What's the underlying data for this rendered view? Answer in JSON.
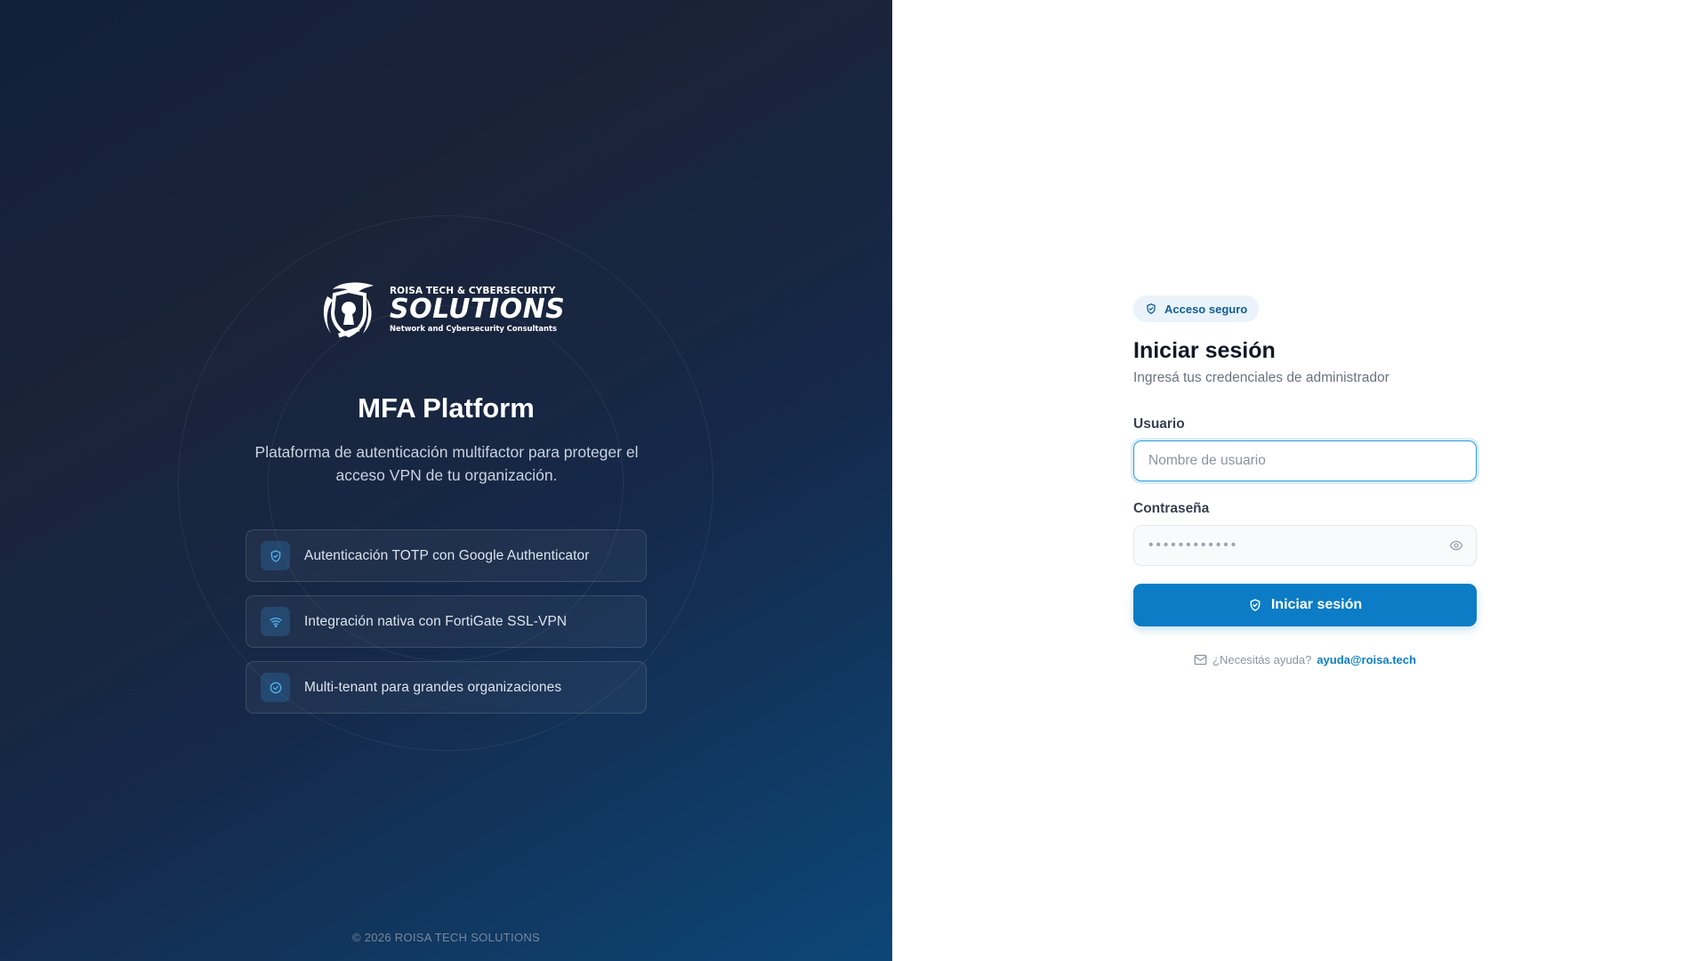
{
  "brand": {
    "logo_top": "ROISA TECH & CYBERSECURITY",
    "logo_main": "SOLUTIONS",
    "logo_bottom": "Network and Cybersecurity Consultants"
  },
  "hero": {
    "title": "MFA Platform",
    "description": "Plataforma de autenticación multifactor para proteger el acceso VPN de tu organización."
  },
  "features": [
    {
      "icon": "shield-check-icon",
      "label": "Autenticación TOTP con Google Authenticator"
    },
    {
      "icon": "wifi-icon",
      "label": "Integración nativa con FortiGate SSL-VPN"
    },
    {
      "icon": "check-circle-icon",
      "label": "Multi-tenant para grandes organizaciones"
    }
  ],
  "footer": {
    "copyright": "© 2026 ROISA TECH SOLUTIONS"
  },
  "login": {
    "badge": "Acceso seguro",
    "title": "Iniciar sesión",
    "subtitle": "Ingresá tus credenciales de administrador",
    "username_label": "Usuario",
    "username_placeholder": "Nombre de usuario",
    "username_value": "",
    "password_label": "Contraseña",
    "password_placeholder": "••••••••••••",
    "password_value": "",
    "submit_label": "Iniciar sesión",
    "help_text": "¿Necesitás ayuda?",
    "help_email": "ayuda@roisa.tech"
  },
  "colors": {
    "accent": "#0b7cc5",
    "panel_dark": "#1a2338",
    "panel_blue": "#0c4778",
    "badge_bg": "#eaf3fa",
    "focus_ring": "#2e9ee0"
  }
}
